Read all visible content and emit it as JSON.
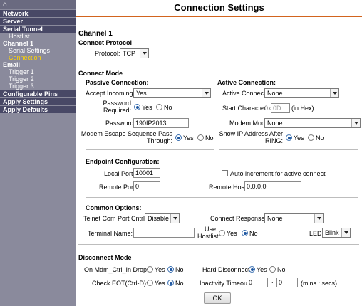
{
  "sidebar": {
    "home_icon": "home-icon",
    "network": "Network",
    "server": "Server",
    "serial_tunnel": "Serial Tunnel",
    "hostlist": "Hostlist",
    "channel1": "Channel 1",
    "serial_settings": "Serial Settings",
    "connection": "Connection",
    "email": "Email",
    "trigger1": "Trigger 1",
    "trigger2": "Trigger 2",
    "trigger3": "Trigger 3",
    "configurable_pins": "Configurable Pins",
    "apply_settings": "Apply Settings",
    "apply_defaults": "Apply Defaults",
    "active_color": "#ffd400",
    "background_color": "#8a8a9c"
  },
  "header": {
    "title": "Connection Settings",
    "accent_color": "#d2641e"
  },
  "channel": {
    "title": "Channel 1"
  },
  "protocol": {
    "heading": "Connect Protocol",
    "label": "Protocol:",
    "value": "TCP"
  },
  "connect_mode": {
    "heading": "Connect Mode",
    "passive": {
      "heading": "Passive Connection:",
      "accept_label": "Accept Incoming:",
      "accept_value": "Yes",
      "password_required_label1": "Password",
      "password_required_label2": "Required:",
      "yes": "Yes",
      "no": "No",
      "password_label": "Password:",
      "password_value": "190IP2013",
      "modem_escape_label1": "Modem Escape Sequence Pass",
      "modem_escape_label2": "Through:"
    },
    "active": {
      "heading": "Active Connection:",
      "active_connect_label": "Active Connect:",
      "active_connect_value": "None",
      "start_char_label": "Start Character:",
      "start_char_prefix": "0x",
      "start_char_placeholder": "0D",
      "start_char_hint": "(in Hex)",
      "modem_mode_label": "Modem Mode:",
      "modem_mode_value": "None",
      "show_ip_label1": "Show IP Address After",
      "show_ip_label2": "RING:",
      "yes": "Yes",
      "no": "No"
    }
  },
  "endpoint": {
    "heading": "Endpoint Configuration:",
    "local_port_label": "Local Port:",
    "local_port_value": "10001",
    "auto_increment_label": "Auto increment for active connect",
    "remote_port_label": "Remote Port:",
    "remote_port_value": "0",
    "remote_host_label": "Remote Host:",
    "remote_host_value": "0.0.0.0"
  },
  "common": {
    "heading": "Common Options:",
    "telnet_label": "Telnet Com Port Cntrl:",
    "telnet_value": "Disable",
    "connect_response_label": "Connect Response:",
    "connect_response_value": "None",
    "terminal_name_label": "Terminal Name:",
    "terminal_name_value": "",
    "use_hostlist_label1": "Use",
    "use_hostlist_label2": "Hostlist:",
    "yes": "Yes",
    "no": "No",
    "led_label": "LED:",
    "led_value": "Blink"
  },
  "disconnect": {
    "heading": "Disconnect Mode",
    "mdm_label": "On Mdm_Ctrl_In Drop:",
    "hard_label": "Hard Disconnect:",
    "eot_label": "Check EOT(Ctrl-D):",
    "inactivity_label": "Inactivity Timeout:",
    "inactivity_min": "0",
    "inactivity_sep": ":",
    "inactivity_sec": "0",
    "inactivity_unit": "(mins : secs)",
    "yes": "Yes",
    "no": "No"
  },
  "ok_label": "OK"
}
